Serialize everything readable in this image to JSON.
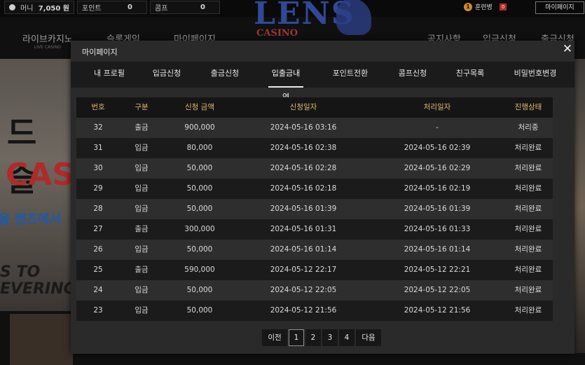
{
  "topbar": {
    "money_label": "머니",
    "money_value": "7,050 원",
    "point_label": "포인트",
    "point_value": "0",
    "comp_label": "콤프",
    "comp_value": "0",
    "user_level": "1",
    "user_name": "훈련병",
    "mail_count": "0",
    "mypage_button": "마이페이지"
  },
  "logo": {
    "text": "LENS",
    "sub": "CASINO"
  },
  "nav": {
    "live_casino": "라이브카지노",
    "live_casino_sub": "LIVE CASINO",
    "slot_game": "슬롯게임",
    "mypage": "마이페이지",
    "notice": "공지사항",
    "deposit": "입금신청",
    "withdraw": "출금신청"
  },
  "background": {
    "t1": "드 슬",
    "t2": "CAS",
    "t3": "을 렌즈에서",
    "t4": "S TO",
    "t5": "EVERING"
  },
  "modal": {
    "title": "마이페이지",
    "close_icon": "close-icon",
    "tabs": [
      "내 프로필",
      "입금신청",
      "출금신청",
      "입출금내역",
      "포인트전환",
      "콤프신청",
      "친구목록",
      "비밀번호변경"
    ],
    "active_tab": "입출금내역",
    "table": {
      "headers": [
        "번호",
        "구분",
        "신청 금액",
        "신청일자",
        "처리일자",
        "진행상태"
      ],
      "rows": [
        [
          "32",
          "출금",
          "900,000",
          "2024-05-16 03:16",
          "-",
          "처리중"
        ],
        [
          "31",
          "입금",
          "80,000",
          "2024-05-16 02:38",
          "2024-05-16 02:39",
          "처리완료"
        ],
        [
          "30",
          "입금",
          "50,000",
          "2024-05-16 02:28",
          "2024-05-16 02:29",
          "처리완료"
        ],
        [
          "29",
          "입금",
          "50,000",
          "2024-05-16 02:18",
          "2024-05-16 02:19",
          "처리완료"
        ],
        [
          "28",
          "입금",
          "50,000",
          "2024-05-16 01:39",
          "2024-05-16 01:39",
          "처리완료"
        ],
        [
          "27",
          "출금",
          "300,000",
          "2024-05-16 01:31",
          "2024-05-16 01:33",
          "처리완료"
        ],
        [
          "26",
          "입금",
          "50,000",
          "2024-05-16 01:14",
          "2024-05-16 01:14",
          "처리완료"
        ],
        [
          "25",
          "출금",
          "590,000",
          "2024-05-12 22:17",
          "2024-05-12 22:21",
          "처리완료"
        ],
        [
          "24",
          "입금",
          "50,000",
          "2024-05-12 22:05",
          "2024-05-12 22:05",
          "처리완료"
        ],
        [
          "23",
          "입금",
          "50,000",
          "2024-05-12 21:56",
          "2024-05-12 21:56",
          "처리완료"
        ]
      ]
    },
    "pagination": {
      "prev": "이전",
      "pages": [
        "1",
        "2",
        "3",
        "4"
      ],
      "current": "1",
      "next": "다음"
    }
  }
}
